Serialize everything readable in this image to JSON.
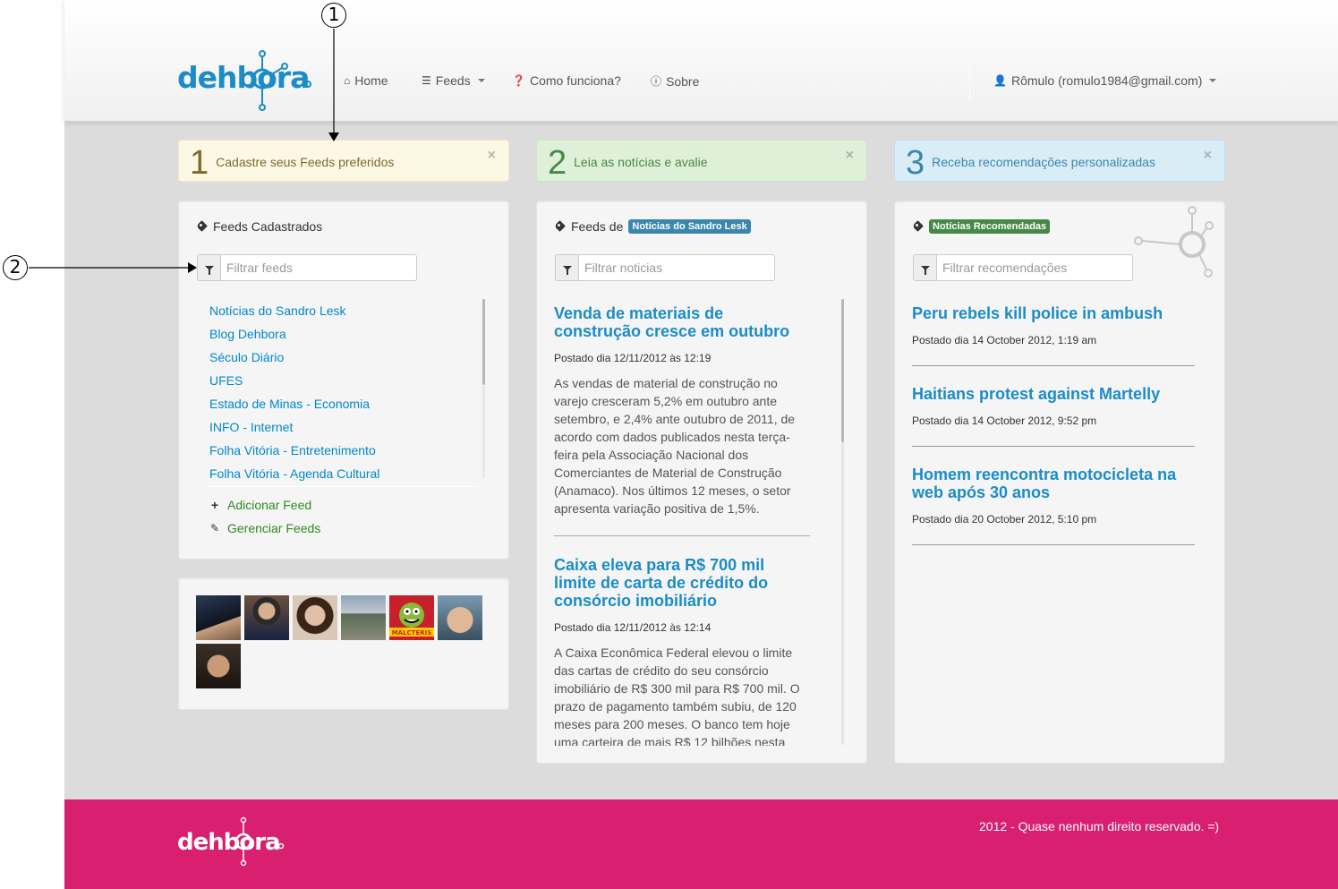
{
  "annotations": {
    "one": "1",
    "two": "2"
  },
  "brand": {
    "name": "dehbora",
    "color": "#1b8cc8"
  },
  "nav": {
    "home": "Home",
    "feeds": "Feeds",
    "how": "Como funciona?",
    "about": "Sobre",
    "user": "Rômulo (romulo1984@gmail.com)"
  },
  "steps": [
    {
      "num": "1",
      "text": "Cadastre seus Feeds preferidos"
    },
    {
      "num": "2",
      "text": "Leia as notícias e avalie"
    },
    {
      "num": "3",
      "text": "Receba recomendações personalizadas"
    }
  ],
  "close_glyph": "×",
  "feeds_panel": {
    "title": "Feeds Cadastrados",
    "filter_placeholder": "Filtrar feeds",
    "items": [
      "Notícias do Sandro Lesk",
      "Blog Dehbora",
      "Século Diário",
      "UFES",
      "Estado de Minas - Economia",
      "INFO - Internet",
      "Folha Vitória - Entretenimento",
      "Folha Vitória - Agenda Cultural"
    ],
    "add": "Adicionar Feed",
    "manage": "Gerenciar Feeds"
  },
  "news_panel": {
    "title_prefix": "Feeds de",
    "title_label": "Notícias do Sandro Lesk",
    "filter_placeholder": "Filtrar noticias",
    "items": [
      {
        "title": "Venda de materiais de construção cresce em outubro",
        "date": "Postado dia 12/11/2012 às 12:19",
        "body": "As vendas de material de construção no varejo cresceram 5,2% em outubro ante setembro, e 2,4% ante outubro de 2011, de acordo com dados publicados nesta terça-feira pela Associação Nacional dos Comerciantes de Material de Construção (Anamaco). Nos últimos 12 meses, o setor apresenta variação positiva de 1,5%."
      },
      {
        "title": "Caixa eleva para R$ 700 mil limite de carta de crédito do consórcio imobiliário",
        "date": "Postado dia 12/11/2012 às 12:14",
        "body": "A Caixa Econômica Federal elevou o limite das cartas de crédito do seu consórcio imobiliário de R$ 300 mil para R$ 700 mil. O prazo de pagamento também subiu, de 120 meses para 200 meses. O banco tem hoje uma carteira de mais R$ 12 bilhões nesta"
      }
    ]
  },
  "rec_panel": {
    "title_label": "Notícias Recomendadas",
    "filter_placeholder": "Filtrar recomendações",
    "items": [
      {
        "title": "Peru rebels kill police in ambush",
        "date": "Postado dia 14 October 2012, 1:19 am"
      },
      {
        "title": "Haitians protest against Martelly",
        "date": "Postado dia 14 October 2012, 9:52 pm"
      },
      {
        "title": "Homem reencontra motocicleta na web após 30 anos",
        "date": "Postado dia 20 October 2012, 5:10 pm"
      }
    ]
  },
  "avatars_badge": "MALCTERIS",
  "footer": {
    "brand": "dehbora",
    "text": "2012 - Quase nenhum direito reservado. =)",
    "color": "#d91f70"
  }
}
